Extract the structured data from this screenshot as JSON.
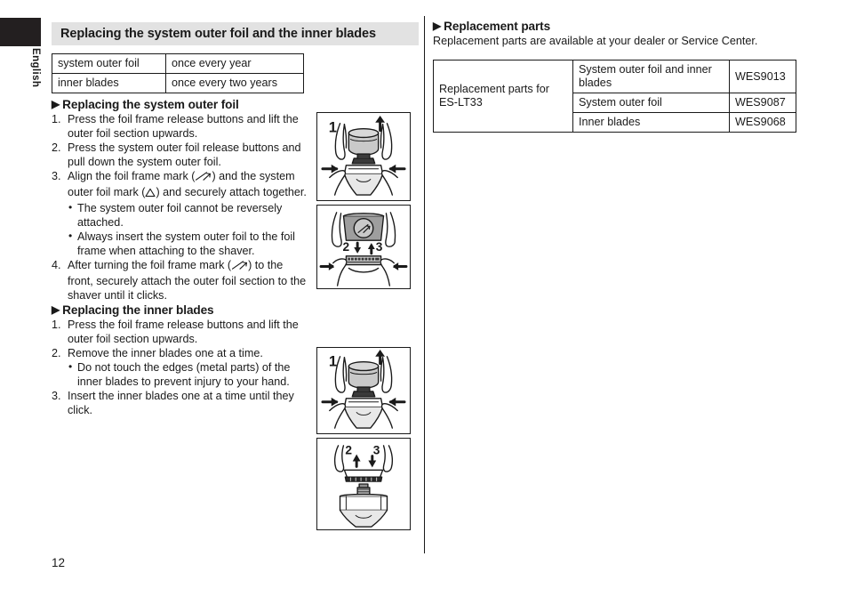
{
  "language_tab": {
    "label": "English"
  },
  "section": {
    "title": "Replacing the system outer foil and the inner blades"
  },
  "maintenance_table": {
    "rows": [
      {
        "part": "system outer foil",
        "interval": "once every year"
      },
      {
        "part": "inner blades",
        "interval": "once every two years"
      }
    ]
  },
  "outer_foil_section": {
    "marker": "▶",
    "heading": "Replacing the system outer foil",
    "steps": [
      {
        "num": "1.",
        "text": "Press the foil frame release buttons and lift the outer foil section upwards."
      },
      {
        "num": "2.",
        "text": "Press the system outer foil release buttons and pull down the system outer foil."
      },
      {
        "num": "3.",
        "text_before": "Align the foil frame mark (",
        "text_middle": ") and the system outer foil mark (",
        "text_after": ") and securely attach together.",
        "bullets": [
          "The system outer foil cannot be reversely attached.",
          "Always insert the system outer foil to the foil frame when attaching to the shaver."
        ]
      },
      {
        "num": "4.",
        "text_before": "After turning the foil frame mark (",
        "text_after": ") to the front, securely attach the outer foil section to the shaver until it clicks."
      }
    ]
  },
  "inner_blades_section": {
    "marker": "▶",
    "heading": "Replacing the inner blades",
    "steps": [
      {
        "num": "1.",
        "text": "Press the foil frame release buttons and lift the outer foil section upwards."
      },
      {
        "num": "2.",
        "text": "Remove the inner blades one at a time.",
        "bullets": [
          "Do not touch the edges (metal parts) of the inner blades to prevent injury to your hand."
        ]
      },
      {
        "num": "3.",
        "text": "Insert the inner blades one at a time until they click."
      }
    ]
  },
  "illustrations": [
    {
      "name": "lift-outer-foil-section",
      "step_labels": [
        "1"
      ]
    },
    {
      "name": "detach-attach-system-outer-foil",
      "step_labels": [
        "2",
        "3"
      ]
    },
    {
      "name": "lift-outer-foil-section-blades",
      "step_labels": [
        "1"
      ]
    },
    {
      "name": "remove-insert-inner-blades",
      "step_labels": [
        "2",
        "3"
      ]
    }
  ],
  "replacement_parts": {
    "marker": "▶",
    "heading": "Replacement parts",
    "note": "Replacement parts are available at your dealer or Service Center.",
    "group_label": "Replacement parts for ES-LT33",
    "rows": [
      {
        "item": "System outer foil and inner blades",
        "code": "WES9013"
      },
      {
        "item": "System outer foil",
        "code": "WES9087"
      },
      {
        "item": "Inner blades",
        "code": "WES9068"
      }
    ]
  },
  "page_number": "12",
  "colors": {
    "ink": "#1a1a1a",
    "title_bar": "#e2e2e2",
    "tab": "#231f20",
    "illustration_fill": "#c9c9c9"
  }
}
